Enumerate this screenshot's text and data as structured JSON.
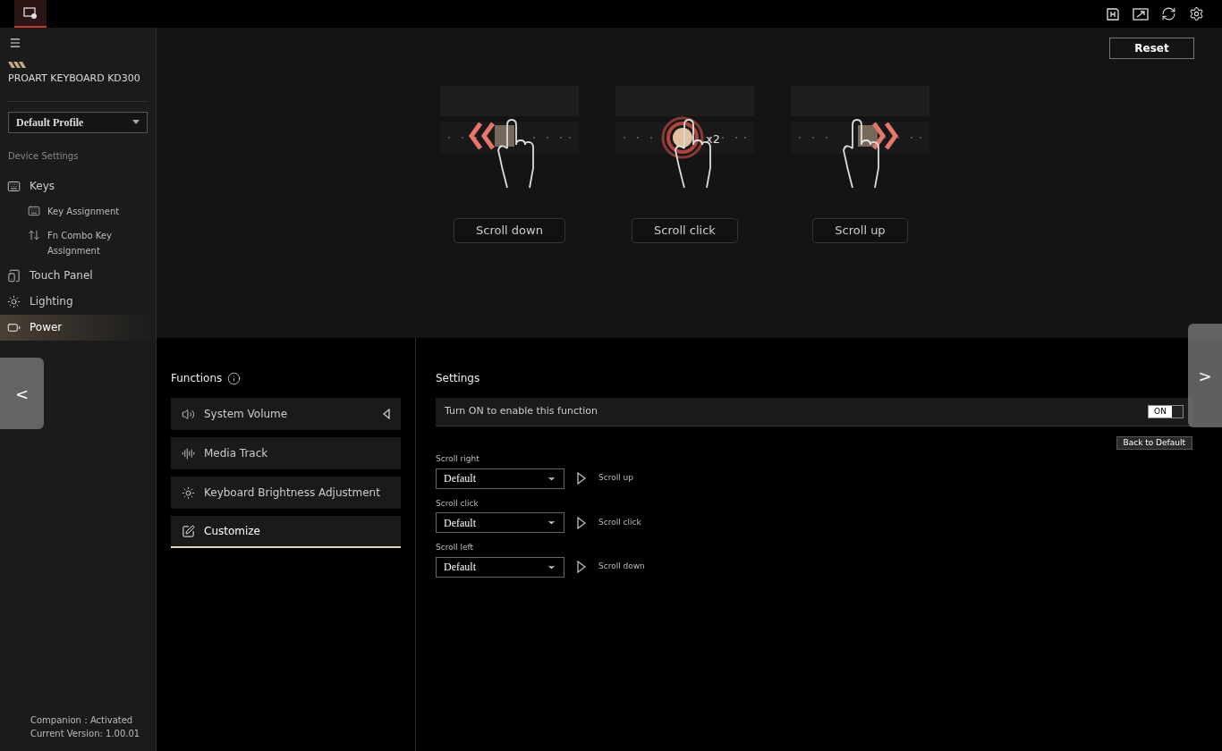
{
  "sidebar": {
    "device_name": "PROART KEYBOARD KD300",
    "profile": "Default Profile",
    "section_label": "Device Settings",
    "items": [
      {
        "label": "Keys",
        "selected": false,
        "children": [
          {
            "label": "Key Assignment",
            "selected": false
          },
          {
            "label": "Fn Combo Key Assignment",
            "selected": false
          }
        ]
      },
      {
        "label": "Touch Panel",
        "selected": false
      },
      {
        "label": "Lighting",
        "selected": false
      },
      {
        "label": "Power",
        "selected": true
      }
    ],
    "footer": [
      "Companion：Activated",
      "Current Version: 1.00.01"
    ]
  },
  "reset_button": "Reset",
  "gestures": [
    {
      "kind": "left",
      "label": "Scroll down"
    },
    {
      "kind": "click",
      "label": "Scroll click",
      "badge": "x2"
    },
    {
      "kind": "right",
      "label": "Scroll up"
    }
  ],
  "functions": {
    "title": "Functions",
    "items": [
      {
        "label": "System Volume",
        "selected": false,
        "pointer": true
      },
      {
        "label": "Media Track",
        "selected": false,
        "pointer": false
      },
      {
        "label": "Keyboard Brightness Adjustment",
        "selected": false,
        "pointer": false
      },
      {
        "label": "Customize",
        "selected": true,
        "pointer": false
      }
    ]
  },
  "settings": {
    "title": "Settings",
    "toggle_label": "Turn ON to enable this function",
    "toggle": {
      "on": true,
      "text": "ON"
    },
    "back_button": "Back to Default",
    "mappings": [
      {
        "label": "Scroll right",
        "value": "Default",
        "result": "Scroll up"
      },
      {
        "label": "Scroll click",
        "value": "Default",
        "result": "Scroll click"
      },
      {
        "label": "Scroll left",
        "value": "Default",
        "result": "Scroll down"
      }
    ]
  },
  "nav_arrows": {
    "previous": "<",
    "next": ">"
  }
}
